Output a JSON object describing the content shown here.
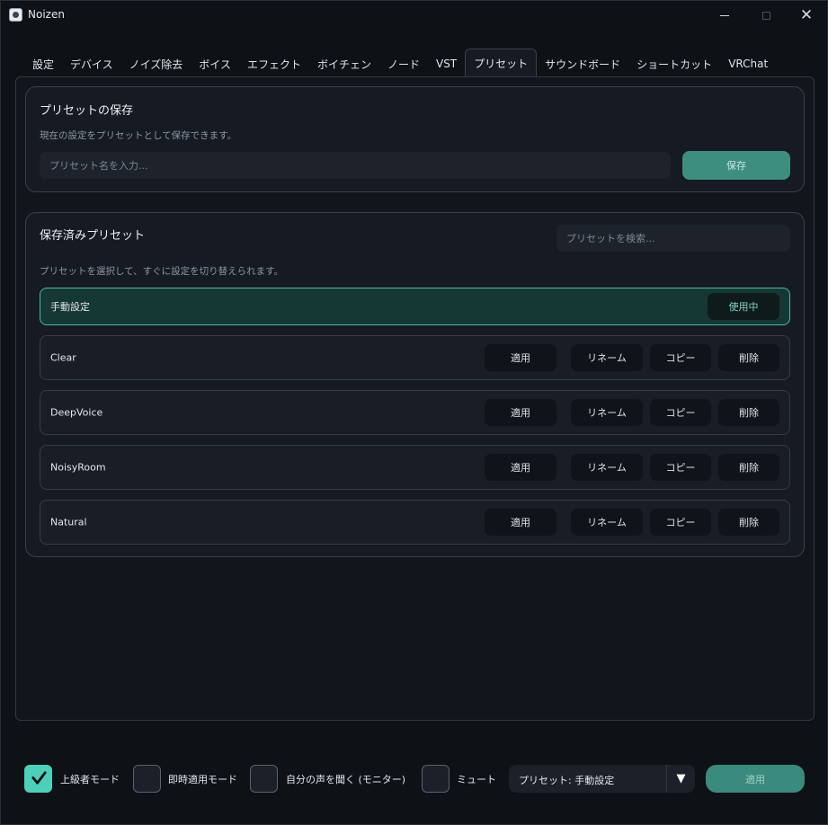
{
  "window": {
    "title": "Noizen",
    "minimize_label": "—",
    "close_label": "✕"
  },
  "tabs": [
    {
      "label": "設定"
    },
    {
      "label": "デバイス"
    },
    {
      "label": "ノイズ除去"
    },
    {
      "label": "ボイス"
    },
    {
      "label": "エフェクト"
    },
    {
      "label": "ボイチェン"
    },
    {
      "label": "ノード"
    },
    {
      "label": "VST"
    },
    {
      "label": "プリセット",
      "active": true
    },
    {
      "label": "サウンドボード"
    },
    {
      "label": "ショートカット"
    },
    {
      "label": "VRChat"
    }
  ],
  "save_card": {
    "title": "プリセットの保存",
    "description": "現在の設定をプリセットとして保存できます。",
    "name_placeholder": "プリセット名を入力...",
    "save_label": "保存"
  },
  "list_card": {
    "title": "保存済みプリセット",
    "search_placeholder": "プリセットを検索...",
    "description": "プリセットを選択して、すぐに設定を切り替えられます。",
    "active_preset": {
      "name": "手動設定",
      "status_label": "使用中"
    },
    "presets": [
      {
        "name": "Clear"
      },
      {
        "name": "DeepVoice"
      },
      {
        "name": "NoisyRoom"
      },
      {
        "name": "Natural"
      }
    ],
    "actions": {
      "apply": "適用",
      "rename": "リネーム",
      "copy": "コピー",
      "delete": "削除"
    }
  },
  "bottom_bar": {
    "advanced_mode": {
      "label": "上級者モード",
      "checked": true
    },
    "instant_apply": {
      "label": "即時適用モード",
      "checked": false
    },
    "monitor": {
      "label": "自分の声を聞く (モニター)",
      "checked": false
    },
    "mute": {
      "label": "ミュート",
      "checked": false
    },
    "preset_select": {
      "value": "プリセット: 手動設定",
      "arrow": "▼"
    },
    "apply_label": "適用"
  },
  "colors": {
    "accent": "#4dd0b9",
    "active_row_bg": "#163834",
    "save_button": "#3e8e80",
    "background": "#0e1116"
  }
}
